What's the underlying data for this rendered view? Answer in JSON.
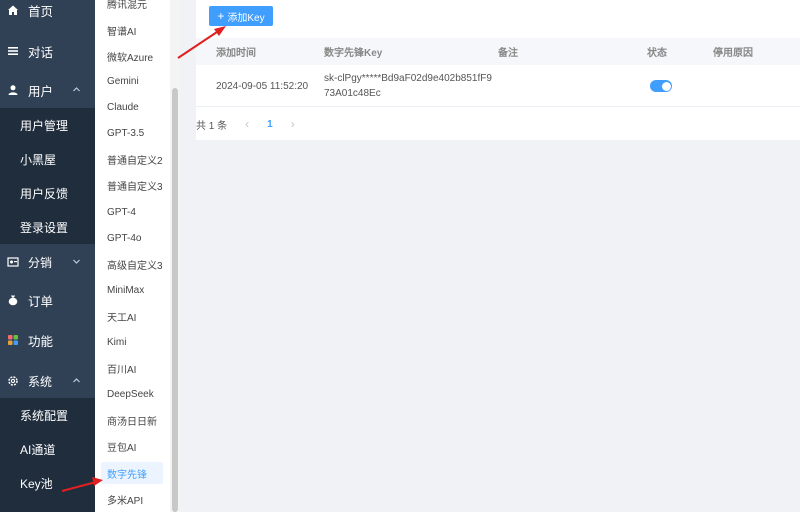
{
  "sidebar": {
    "items": [
      {
        "label": "首页",
        "icon": "home-icon"
      },
      {
        "label": "对话",
        "icon": "menu-icon"
      },
      {
        "label": "用户",
        "icon": "user-icon"
      },
      {
        "label": "分销",
        "icon": "share-icon"
      },
      {
        "label": "订单",
        "icon": "moneybag-icon"
      },
      {
        "label": "功能",
        "icon": "apps-icon"
      },
      {
        "label": "系统",
        "icon": "gear-icon"
      }
    ],
    "user_sub": [
      "用户管理",
      "小黑屋",
      "用户反馈",
      "登录设置"
    ],
    "system_sub": [
      "系统配置",
      "AI通道",
      "Key池"
    ]
  },
  "channels": {
    "items": [
      "腾讯混元",
      "智谱AI",
      "微软Azure",
      "Gemini",
      "Claude",
      "GPT-3.5",
      "普通自定义2",
      "普通自定义3",
      "GPT-4",
      "GPT-4o",
      "高级自定义3",
      "MiniMax",
      "天工AI",
      "Kimi",
      "百川AI",
      "DeepSeek",
      "商汤日日新",
      "豆包AI",
      "数字先锋",
      "多米API"
    ],
    "active": "数字先锋"
  },
  "toolbar": {
    "add_label": "添加Key",
    "add_plus": "+"
  },
  "table": {
    "headers": {
      "time": "添加时间",
      "key": "数字先锋Key",
      "remark": "备注",
      "status": "状态",
      "reason": "停用原因"
    },
    "rows": [
      {
        "time": "2024-09-05 11:52:20",
        "key": "sk-clPgy*****Bd9aF02d9e402b851fF973A01c48Ec",
        "remark": "",
        "status_on": true,
        "reason": ""
      }
    ]
  },
  "pagination": {
    "total": "共 1 条",
    "prev": "‹",
    "page": "1",
    "next": "›"
  },
  "colors": {
    "sidebar": "#304156",
    "submenu": "#1f2d3d",
    "accent": "#409eff",
    "annotation": "#e02020"
  }
}
